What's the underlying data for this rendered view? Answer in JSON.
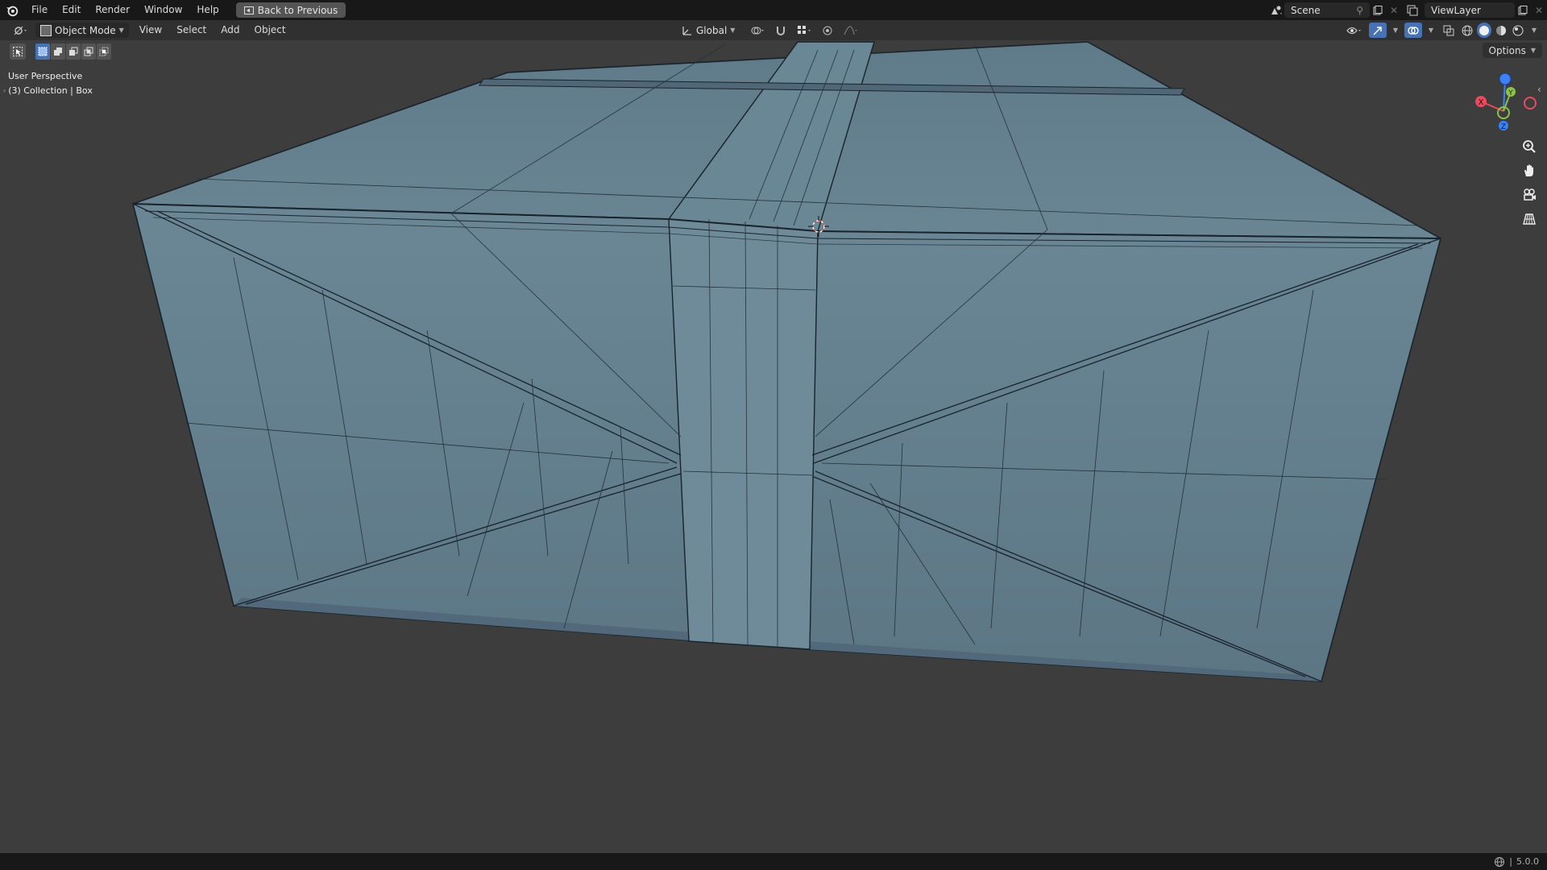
{
  "topbar": {
    "menus": [
      "File",
      "Edit",
      "Render",
      "Window",
      "Help"
    ],
    "back_label": "Back to Previous",
    "scene_value": "Scene",
    "viewlayer_value": "ViewLayer"
  },
  "viewport_header": {
    "mode": "Object Mode",
    "menus": [
      "View",
      "Select",
      "Add",
      "Object"
    ],
    "orientation": "Global"
  },
  "toolbar": {
    "options_label": "Options"
  },
  "overlay": {
    "perspective": "User Perspective",
    "collection": "(3) Collection | Box"
  },
  "gizmo": {
    "axis_x": "X",
    "axis_y": "Y",
    "axis_z": "Z",
    "color_x": "#e84a5f",
    "color_y": "#8bc34a",
    "color_z": "#3b82f6"
  },
  "colors": {
    "viewport_bg": "#3d3d3d",
    "mesh_face": "#637e8c",
    "mesh_wire": "#15202a",
    "accent": "#4772b3"
  },
  "statusbar": {
    "version": "5.0.0"
  }
}
